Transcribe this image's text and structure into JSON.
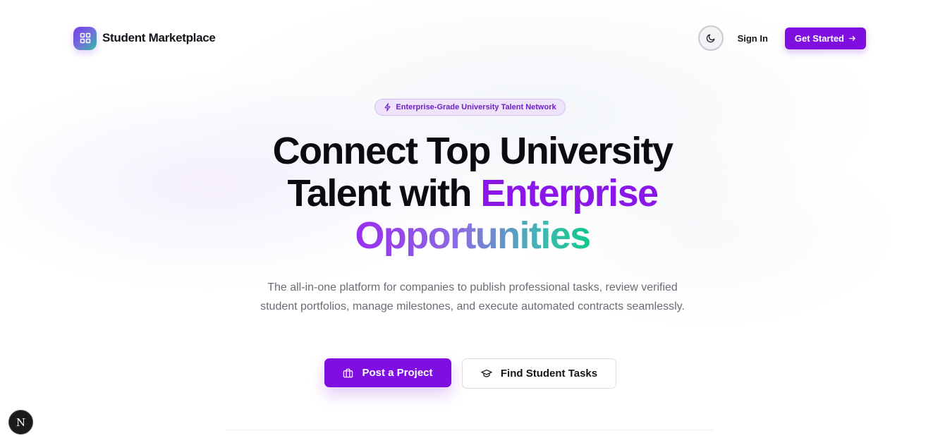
{
  "header": {
    "brand_name": "Student Marketplace",
    "logo_icon": "grid-icon",
    "theme_icon": "moon-icon",
    "sign_in_label": "Sign In",
    "get_started_label": "Get Started",
    "get_started_icon": "arrow-right-icon"
  },
  "hero": {
    "badge_icon": "lightning-icon",
    "badge_text": "Enterprise-Grade University Talent Network",
    "headline_line1": "Connect Top University",
    "headline_line2_plain": "Talent with ",
    "headline_line2_accent": "Enterprise",
    "headline_line3_gradient": "Opportunities",
    "description": "The all-in-one platform for companies to publish professional tasks, review verified student portfolios, manage milestones, and execute automated contracts seamlessly.",
    "primary_cta_icon": "briefcase-icon",
    "primary_cta_label": "Post a Project",
    "secondary_cta_icon": "graduation-cap-icon",
    "secondary_cta_label": "Find Student Tasks"
  },
  "dev_badge": {
    "label": "N"
  },
  "colors": {
    "accent": "#7e0fe0",
    "accent_text": "#8a17e8",
    "gradient_start": "#9a2cf0",
    "gradient_end": "#10c98d",
    "badge_bg": "#efe3fb"
  }
}
